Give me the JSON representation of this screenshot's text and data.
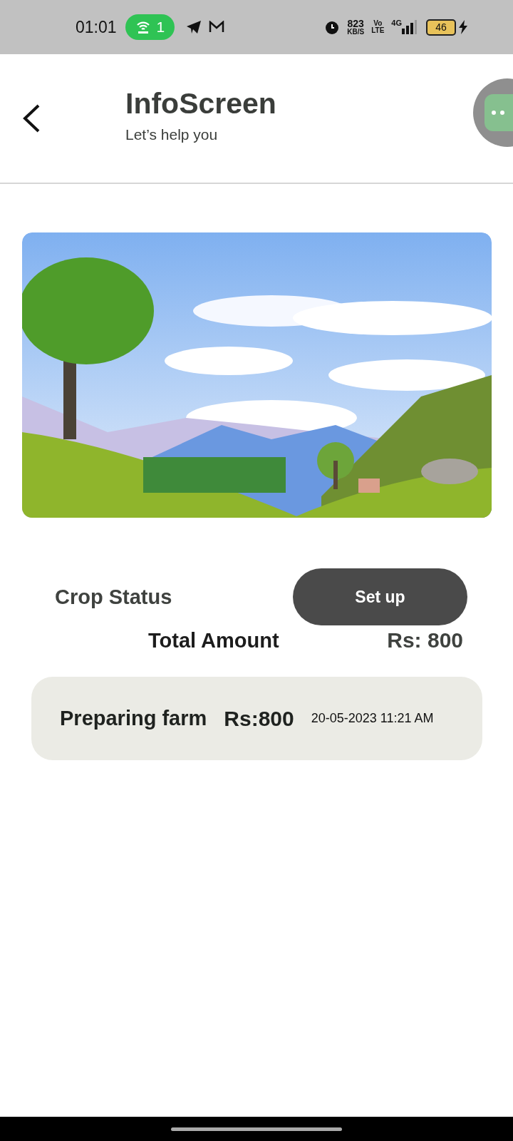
{
  "status_bar": {
    "time": "01:01",
    "hotspot_count": "1",
    "speed": "823",
    "speed_unit": "KB/S",
    "volte_top": "Vo",
    "volte_bottom": "LTE",
    "network": "4G",
    "battery": "46"
  },
  "header": {
    "title": "InfoScreen",
    "subtitle": "Let’s help you"
  },
  "crop_status": {
    "label": "Crop Status",
    "button": "Set up"
  },
  "total": {
    "label": "Total Amount",
    "amount": "Rs: 800"
  },
  "entries": [
    {
      "name": "Preparing farm",
      "amount": "Rs:800",
      "datetime": "20-05-2023 11:21 AM"
    }
  ]
}
